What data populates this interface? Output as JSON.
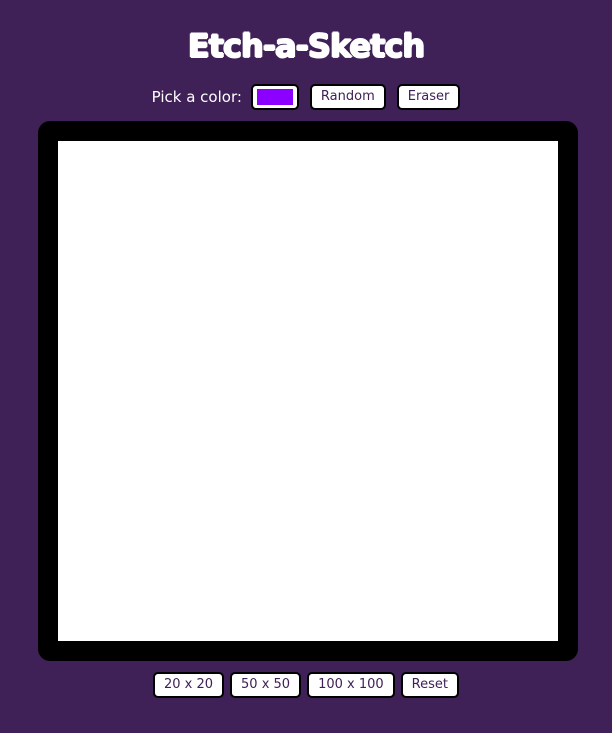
{
  "header": {
    "title": "Etch-a-Sketch"
  },
  "controls": {
    "pick_label": "Pick a color:",
    "selected_color": "#8c00ff",
    "random_label": "Random",
    "eraser_label": "Eraser"
  },
  "canvas": {
    "background": "#ffffff"
  },
  "grid_sizes": {
    "size_20_label": "20 x 20",
    "size_50_label": "50 x 50",
    "size_100_label": "100 x 100",
    "reset_label": "Reset"
  },
  "colors": {
    "page_background": "#3f2157",
    "frame": "#000000"
  }
}
